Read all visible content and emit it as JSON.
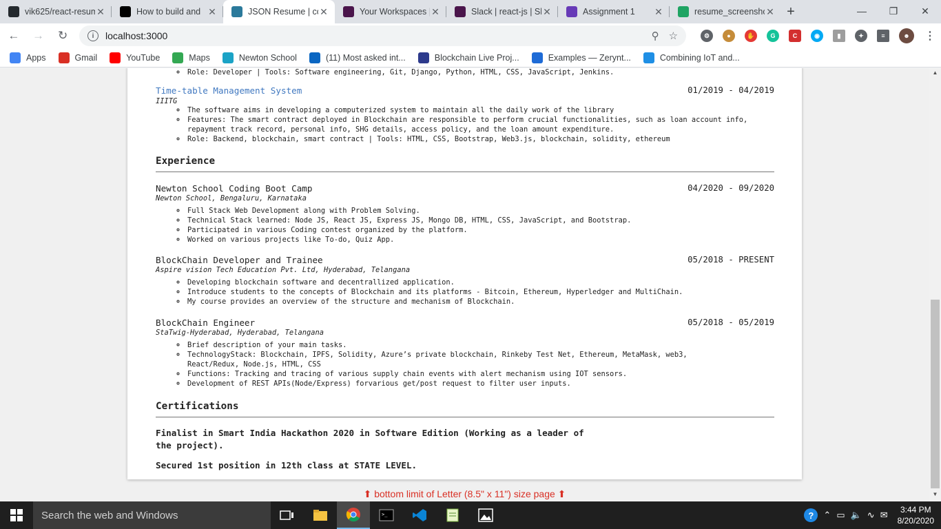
{
  "browser": {
    "tabs": [
      {
        "title": "vik625/react-resum",
        "icon": "github-icon",
        "color": "#24292e"
      },
      {
        "title": "How to build and",
        "icon": "medium-icon",
        "color": "#000000"
      },
      {
        "title": "JSON Resume | co",
        "icon": "jsonresume-icon",
        "color": "#2b7a9b",
        "active": true
      },
      {
        "title": "Your Workspaces |",
        "icon": "slack-icon",
        "color": "#4a154b"
      },
      {
        "title": "Slack | react-js | Sl",
        "icon": "slack-icon",
        "color": "#4a154b"
      },
      {
        "title": "Assignment 1",
        "icon": "forms-icon",
        "color": "#673ab7"
      },
      {
        "title": "resume_screensho",
        "icon": "drive-icon",
        "color": "#1fa463"
      }
    ],
    "new_tab_label": "+",
    "url": "localhost:3000",
    "bookmarks": [
      {
        "label": "Apps",
        "icon": "apps-grid-icon",
        "color": "#4285f4"
      },
      {
        "label": "Gmail",
        "icon": "gmail-icon",
        "color": "#d93025"
      },
      {
        "label": "YouTube",
        "icon": "youtube-icon",
        "color": "#ff0000"
      },
      {
        "label": "Maps",
        "icon": "maps-icon",
        "color": "#34a853"
      },
      {
        "label": "Newton School",
        "icon": "newton-icon",
        "color": "#1ba3c6"
      },
      {
        "label": "(11) Most asked int...",
        "icon": "linkedin-icon",
        "color": "#0a66c2"
      },
      {
        "label": "Blockchain Live Proj...",
        "icon": "blockchain-icon",
        "color": "#2d3a8c"
      },
      {
        "label": "Examples — Zerynt...",
        "icon": "zeryn-icon",
        "color": "#1e6bd6"
      },
      {
        "label": "Combining IoT and...",
        "icon": "hackster-icon",
        "color": "#1f8fe5"
      }
    ]
  },
  "resume": {
    "prev_project_role": "Role: Developer | Tools: Software engineering, Git, Django, Python, HTML, CSS, JavaScript, Jenkins.",
    "project": {
      "title": "Time-table Management System",
      "date": "01/2019 - 04/2019",
      "org": "IIITG",
      "bullets": [
        "The software aims in developing a computerized system to maintain all the daily work of the library",
        "Features: The smart contract deployed in Blockchain are responsible to perform crucial functionalities, such as loan account info, repayment track record, personal info, SHG details, access policy, and the loan amount expenditure.",
        "Role: Backend, blockchain, smart contract | Tools: HTML, CSS, Bootstrap, Web3.js, blockchain, solidity, ethereum"
      ]
    },
    "experience_heading": "Experience",
    "experience": [
      {
        "title": "Newton School Coding Boot Camp",
        "date": "04/2020 - 09/2020",
        "org": "Newton School, Bengaluru, Karnataka",
        "bullets": [
          "Full Stack Web Development along with Problem Solving.",
          "Technical Stack learned: Node JS, React JS, Express JS, Mongo DB, HTML, CSS, JavaScript, and Bootstrap.",
          "Participated in various Coding contest organized by the platform.",
          "Worked on various projects like To-do, Quiz App."
        ]
      },
      {
        "title": "BlockChain Developer and Trainee",
        "date": "05/2018 - PRESENT",
        "org": "Aspire vision Tech Education Pvt. Ltd, Hyderabad, Telangana",
        "bullets": [
          "Developing blockchain software and decentrallized application.",
          "Introduce students to the concepts of Blockchain and its platforms - Bitcoin, Ethereum, Hyperledger and MultiChain.",
          "My course provides an overview of the structure and mechanism of Blockchain."
        ]
      },
      {
        "title": "BlockChain Engineer",
        "date": "05/2018 - 05/2019",
        "org": "StaTwig-Hyderabad, Hyderabad, Telangana",
        "bullets": [
          "Brief description of your main tasks.",
          "TechnologyStack: Blockchain, IPFS, Solidity, Azure’s private blockchain, Rinkeby Test Net, Ethereum, MetaMask, web3, React/Redux, Node.js, HTML, CSS",
          "Functions: Tracking and tracing of various supply chain events with alert mechanism using IOT sensors.",
          "Development of REST APIs(Node/Express) forvarious get/post request to filter user inputs."
        ]
      }
    ],
    "certifications_heading": "Certifications",
    "certifications": [
      "Finalist in Smart India Hackathon 2020 in Software Edition (Working as a leader of the project).",
      "Secured 1st position in 12th class at STATE LEVEL."
    ],
    "page_limit_note": "⬆ bottom limit of Letter (8.5\" x 11\") size page ⬆"
  },
  "taskbar": {
    "search_placeholder": "Search the web and Windows",
    "time": "3:44 PM",
    "date": "8/20/2020"
  }
}
